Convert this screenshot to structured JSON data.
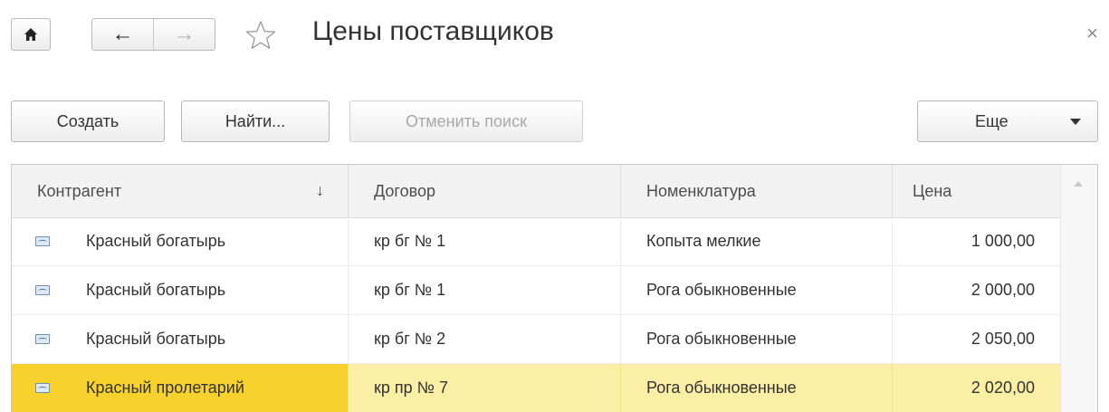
{
  "window": {
    "title": "Цены поставщиков",
    "close_glyph": "×"
  },
  "toolbar": {
    "create_label": "Создать",
    "find_label": "Найти...",
    "cancel_search_label": "Отменить поиск",
    "more_label": "Еще"
  },
  "table": {
    "columns": [
      "Контрагент",
      "Договор",
      "Номенклатура",
      "Цена"
    ],
    "sort_column": "Контрагент",
    "rows": [
      {
        "counterparty": "Красный богатырь",
        "contract": "кр бг № 1",
        "item": "Копыта мелкие",
        "price": "1 000,00"
      },
      {
        "counterparty": "Красный богатырь",
        "contract": "кр бг № 1",
        "item": "Рога обыкновенные",
        "price": "2 000,00"
      },
      {
        "counterparty": "Красный богатырь",
        "contract": "кр бг № 2",
        "item": "Рога обыкновенные",
        "price": "2 050,00"
      },
      {
        "counterparty": "Красный пролетарий",
        "contract": "кр пр № 7",
        "item": "Рога обыкновенные",
        "price": "2 020,00"
      }
    ],
    "selected_row": 3
  },
  "colors": {
    "selected_row": "#fbeea5",
    "selected_cell": "#f7d22d"
  },
  "icons": {
    "home": "home-icon",
    "back": "arrow-left-icon",
    "forward": "arrow-right-icon",
    "favorite": "star-icon",
    "close": "close-icon",
    "sort": "sort-arrow-down-icon",
    "row": "catalog-item-icon"
  }
}
